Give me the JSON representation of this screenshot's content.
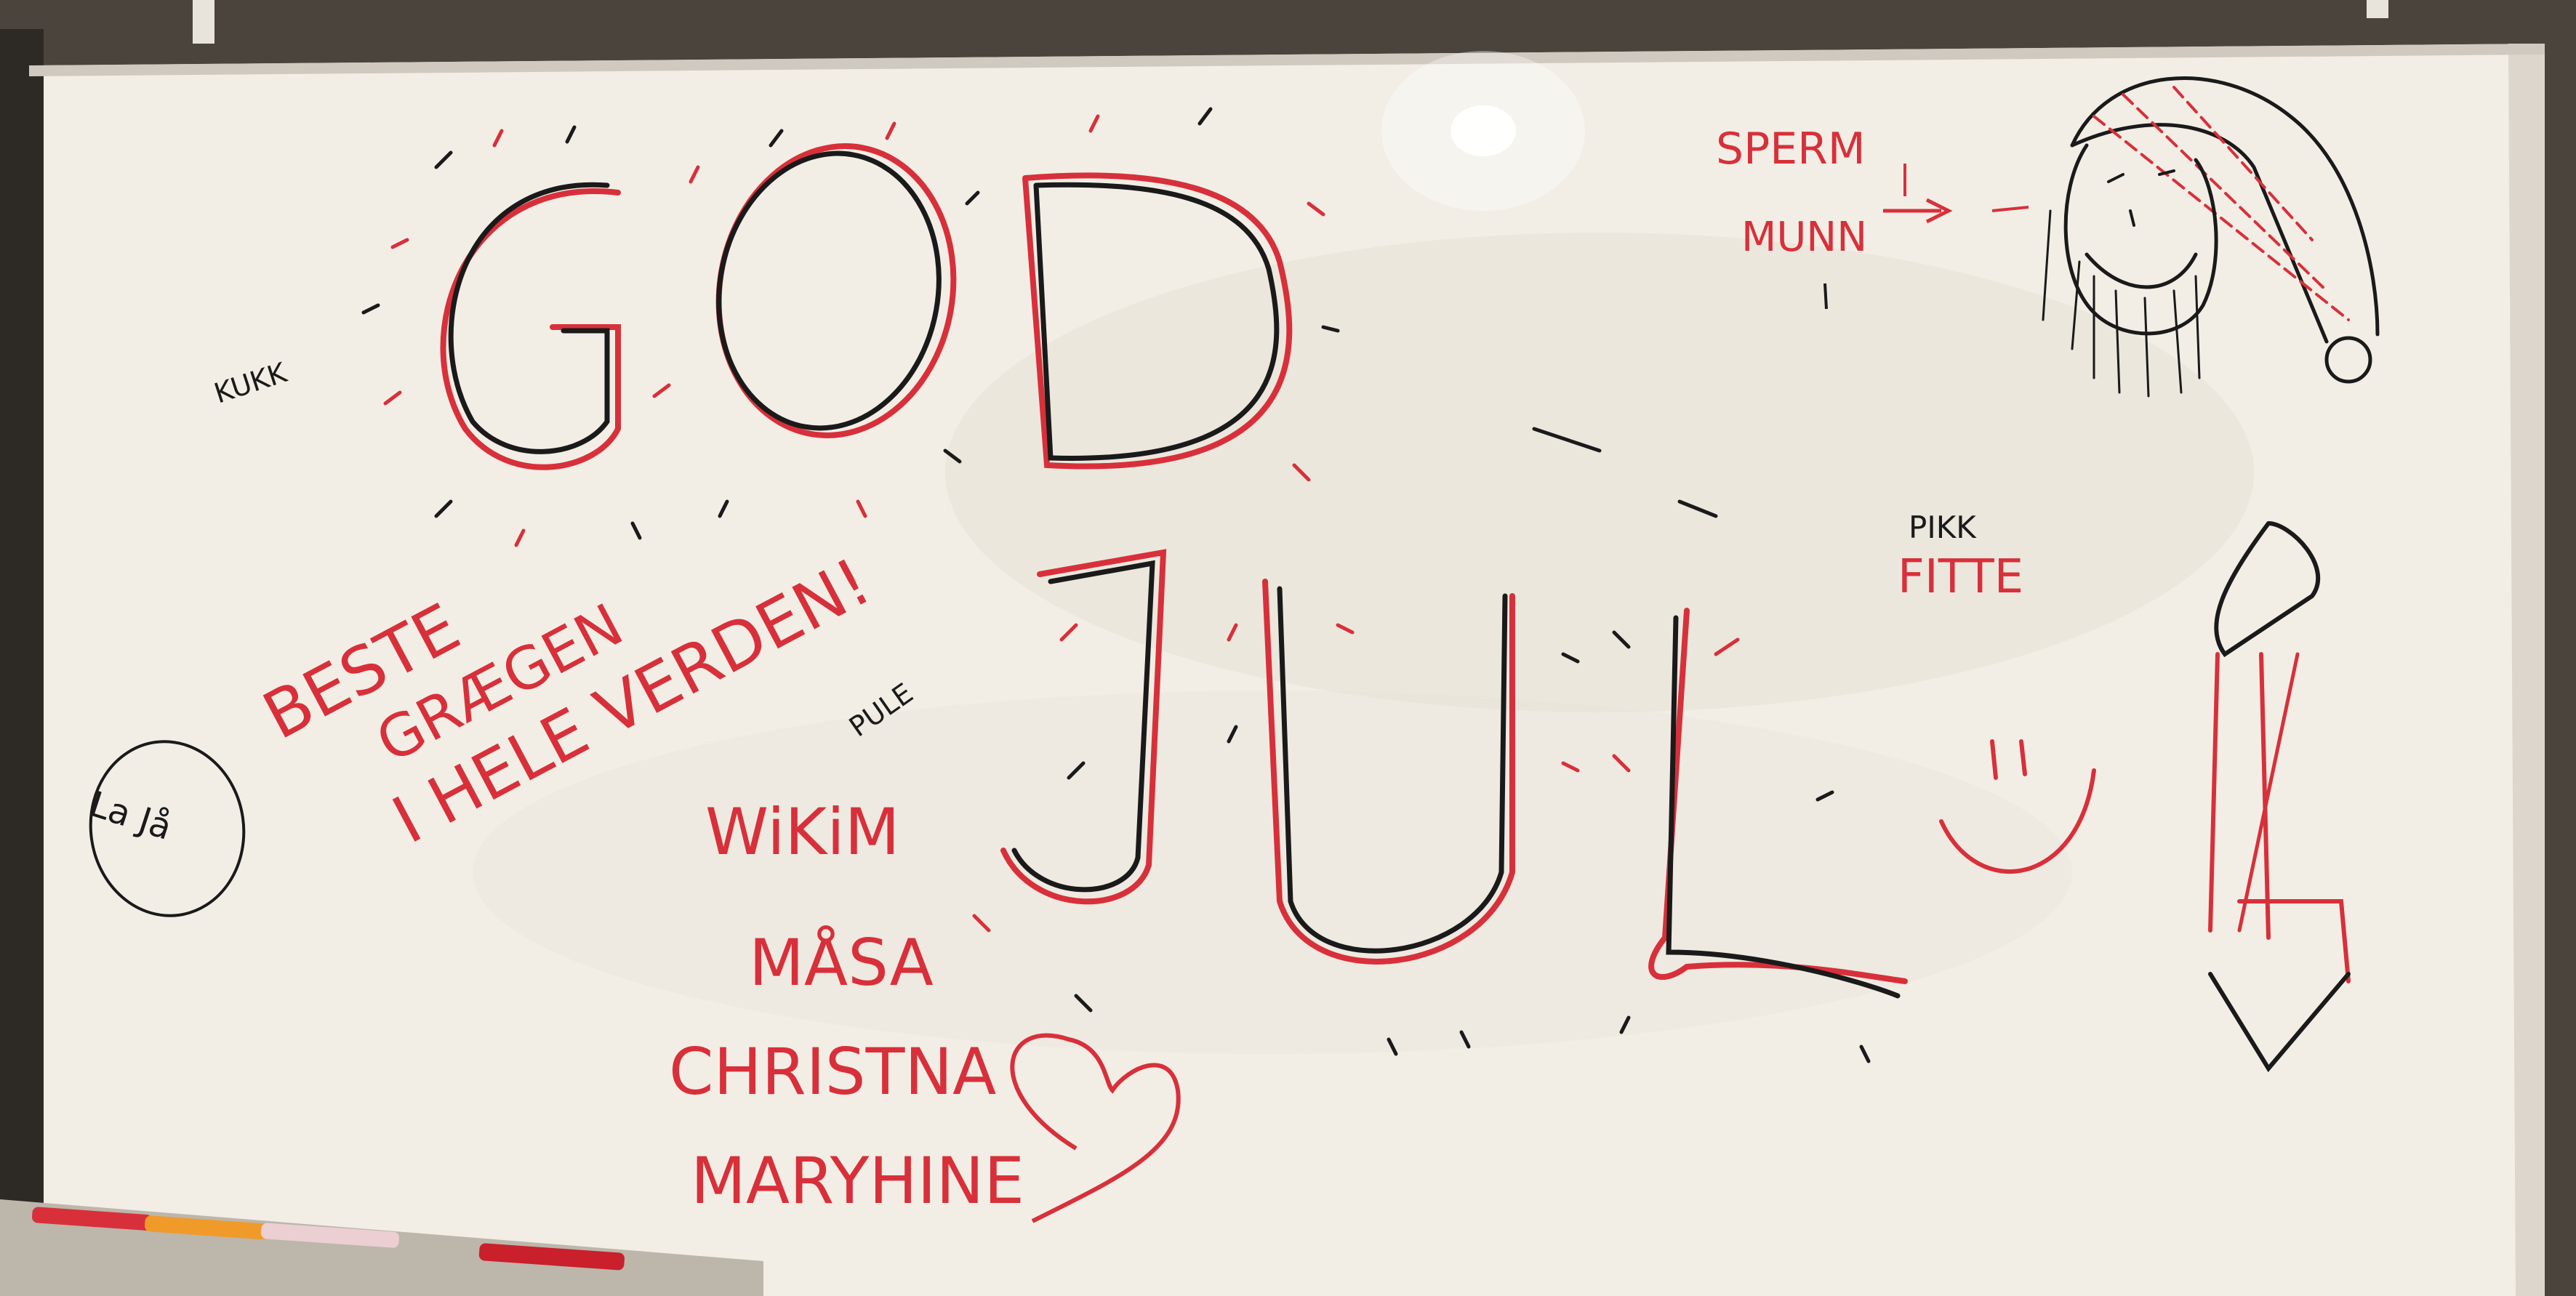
{
  "whiteboard": {
    "colors": {
      "board": "#f1ede4",
      "ink_red": "#d8303a",
      "ink_black": "#1a1a1a",
      "frame": "#cfc9bf"
    },
    "main_words": [
      "GOD",
      "JUL"
    ],
    "exclamation": "!",
    "notes": {
      "kukk": "KUKK",
      "la_ga": "La Jå",
      "beste_greetings": [
        "BESTE",
        "GRÆGEN",
        "I HELE VERDEN!"
      ],
      "pule": "PULE",
      "names": [
        "WiKiM",
        "MÅSA",
        "CHRISTNA",
        "MARYHINE"
      ],
      "sperm": "SPERM",
      "munn": "MUNN",
      "pikk": "PIKK",
      "fitte": "FITTE"
    },
    "drawings": [
      "santa-face-icon",
      "smiley-face-icon",
      "heart-icon",
      "glow-rays"
    ],
    "markers": [
      "red-marker",
      "orange-marker",
      "pink-marker",
      "red-marker-cap"
    ]
  }
}
